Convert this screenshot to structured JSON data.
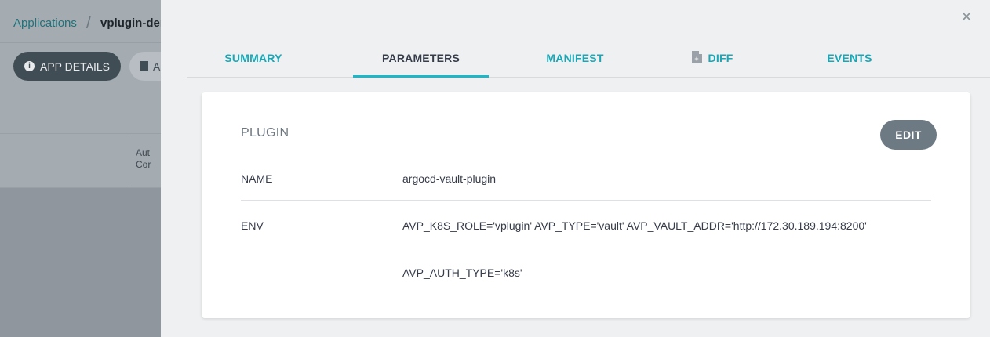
{
  "background": {
    "breadcrumb": {
      "link": "Applications",
      "current": "vplugin-dem"
    },
    "app_details_button": "APP DETAILS",
    "second_button": "A",
    "cell_text": "Aut\nCor"
  },
  "panel": {
    "close_symbol": "×",
    "tabs": [
      {
        "label": "SUMMARY",
        "active": false
      },
      {
        "label": "PARAMETERS",
        "active": true
      },
      {
        "label": "MANIFEST",
        "active": false
      },
      {
        "label": "DIFF",
        "active": false
      },
      {
        "label": "EVENTS",
        "active": false
      }
    ],
    "card": {
      "title": "PLUGIN",
      "edit_label": "EDIT",
      "name": {
        "label": "NAME",
        "value": "argocd-vault-plugin"
      },
      "env": {
        "label": "ENV",
        "values": [
          "AVP_K8S_ROLE='vplugin' AVP_TYPE='vault' AVP_VAULT_ADDR='http://172.30.189.194:8200'",
          "AVP_AUTH_TYPE='k8s'"
        ]
      }
    }
  },
  "colors": {
    "tab_accent": "#17a8b8",
    "active_underline": "#1cb8c8",
    "edit_button": "#6d7a83",
    "overlay": "#8f969d"
  }
}
